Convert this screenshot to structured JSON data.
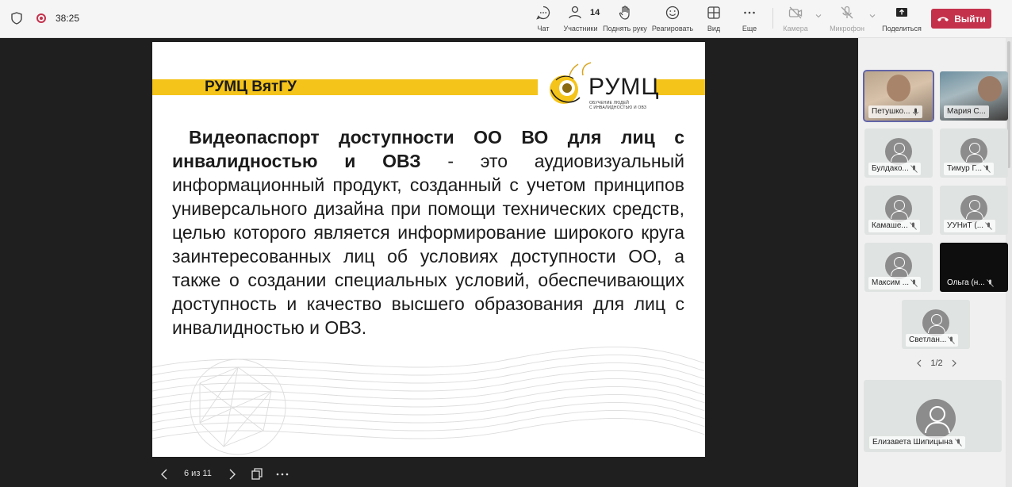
{
  "timer": "38:25",
  "toolbar": {
    "chat": "Чат",
    "participants": "Участники",
    "participants_count": "14",
    "raise_hand": "Поднять руку",
    "react": "Реагировать",
    "view": "Вид",
    "more": "Еще",
    "camera": "Камера",
    "mic": "Микрофон",
    "share": "Поделиться",
    "leave": "Выйти"
  },
  "slide": {
    "header": "РУМЦ ВятГУ",
    "logo_text": "РУМЦ",
    "logo_sub1": "ОБУЧЕНИЕ ЛЮДЕЙ",
    "logo_sub2": "С ИНВАЛИДНОСТЬЮ И ОВЗ",
    "bold_part": "Видеопаспорт доступности ОО ВО для лиц с инвалидностью и ОВЗ",
    "rest_part": " - это аудиовизуальный информационный продукт, созданный с учетом принципов универсального дизайна при помощи технических средств, целью которого является информирование широкого круга заинтересованных лиц об условиях доступности ОО, а также о создании специальных условий, обеспечивающих доступность и качество высшего образования для лиц с инвалидностью и ОВЗ."
  },
  "slide_nav": {
    "counter": "6 из 11"
  },
  "participants": [
    {
      "name": "Петушко..."
    },
    {
      "name": "Мария С..."
    },
    {
      "name": "Булдако..."
    },
    {
      "name": "Тимур Г..."
    },
    {
      "name": "Камаше..."
    },
    {
      "name": "УУНиТ (..."
    },
    {
      "name": "Максим ..."
    },
    {
      "name": "Ольга (н..."
    },
    {
      "name": "Светлан..."
    }
  ],
  "pager": "1/2",
  "featured": {
    "name": "Елизавета Шипицына"
  },
  "colors": {
    "accent": "#f5c41a",
    "leave": "#c4314b",
    "brand": "#6264a7"
  }
}
